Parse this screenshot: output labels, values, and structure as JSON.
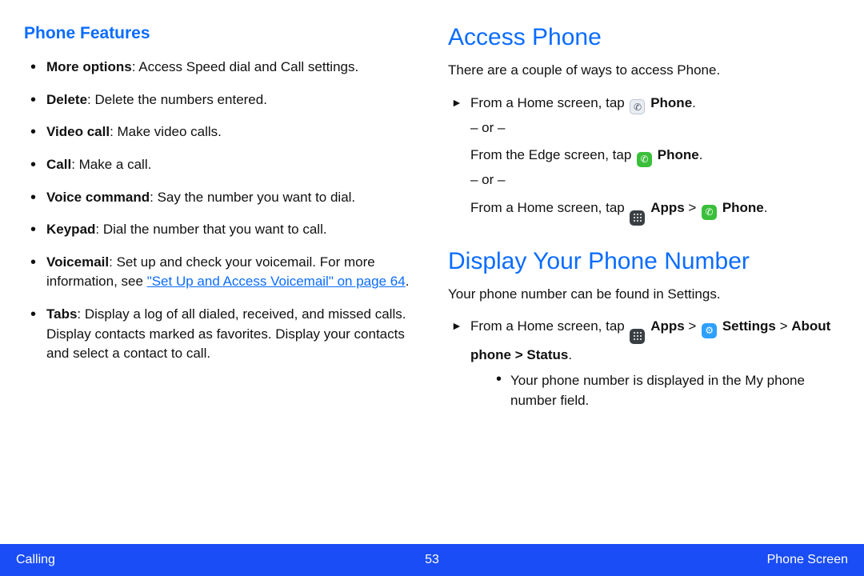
{
  "left": {
    "heading": "Phone Features",
    "items": [
      {
        "label": "More options",
        "desc": ": Access Speed dial and Call settings."
      },
      {
        "label": "Delete",
        "desc": ": Delete the numbers entered."
      },
      {
        "label": "Video call",
        "desc": ": Make video calls."
      },
      {
        "label": "Call",
        "desc": ": Make a call."
      },
      {
        "label": "Voice command",
        "desc": ": Say the number you want to dial."
      },
      {
        "label": "Keypad",
        "desc": ": Dial the number that you want to call."
      },
      {
        "label": "Voicemail",
        "desc": ": Set up and check your voicemail. For more information, see ",
        "link": "\"Set Up and Access Voicemail\" on page 64",
        "desc_after": "."
      },
      {
        "label": "Tabs",
        "desc": ": Display a log of all dialed, received, and missed calls. Display contacts marked as favorites. Display your contacts and select a contact to call."
      }
    ]
  },
  "right": {
    "access": {
      "heading": "Access Phone",
      "intro": "There are a couple of ways to access Phone.",
      "step1_prefix": "From a Home screen, tap ",
      "step1_phone": "Phone",
      "step1_suffix": ".",
      "or": "– or –",
      "step2_prefix": "From the Edge screen, tap ",
      "step2_phone": "Phone",
      "step2_suffix": ".",
      "step3_prefix": "From a Home screen, tap ",
      "step3_apps": "Apps",
      "gt": " > ",
      "step3_phone": "Phone",
      "step3_suffix": "."
    },
    "display_num": {
      "heading": "Display Your Phone Number",
      "intro": "Your phone number can be found in Settings.",
      "step_prefix": "From a Home screen, tap ",
      "apps": "Apps",
      "gt1": " > ",
      "settings": "Settings",
      "gt2": " > ",
      "about_phone": "About phone",
      "gt3": " > ",
      "status": "Status",
      "suffix": ".",
      "sub_point": "Your phone number is displayed in the My phone number field."
    }
  },
  "footer": {
    "left": "Calling",
    "page": "53",
    "right": "Phone Screen"
  },
  "icons": {
    "phone_glyph": "✆",
    "handset_glyph": "✆",
    "gear_glyph": "⚙"
  }
}
